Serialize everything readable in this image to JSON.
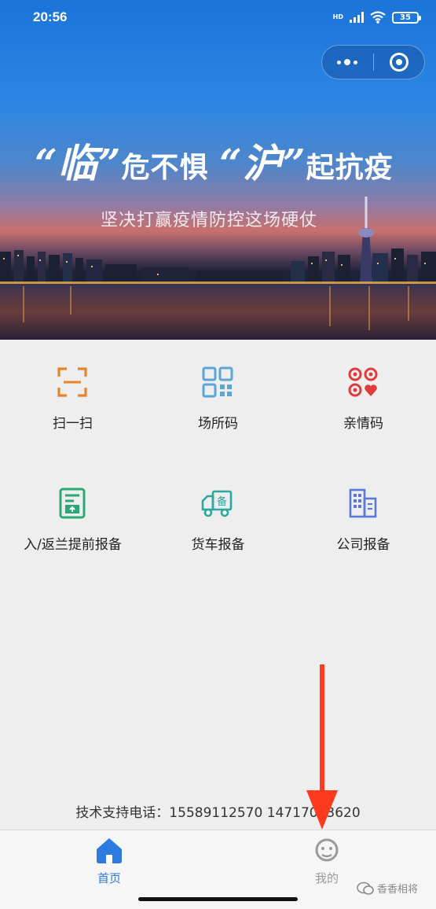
{
  "status_bar": {
    "time": "20:56",
    "hd": "HD",
    "battery": "35"
  },
  "banner": {
    "slogan_main_part1": "“临”",
    "slogan_main_part2": "危不惧",
    "slogan_main_part3": "“沪”",
    "slogan_main_part4": "起抗疫",
    "slogan_sub": "坚决打赢疫情防控这场硬仗"
  },
  "grid_items": [
    {
      "label": "扫一扫",
      "icon": "scan-icon",
      "color": "#e8852b"
    },
    {
      "label": "场所码",
      "icon": "qr-code-icon",
      "color": "#5aa6d9"
    },
    {
      "label": "亲情码",
      "icon": "family-code-icon",
      "color": "#e03b3b"
    },
    {
      "label": "入/返兰提前报备",
      "icon": "entry-report-icon",
      "color": "#2aa876"
    },
    {
      "label": "货车报备",
      "icon": "truck-icon",
      "color": "#2aa8a0"
    },
    {
      "label": "公司报备",
      "icon": "building-icon",
      "color": "#5b78d8"
    }
  ],
  "support_text": "技术支持电话：15589112570  14717053620",
  "tabbar": {
    "home_label": "首页",
    "mine_label": "我的"
  },
  "watermark": "香香相将",
  "colors": {
    "accent": "#2d7be0",
    "arrow": "#ff3b1f"
  }
}
